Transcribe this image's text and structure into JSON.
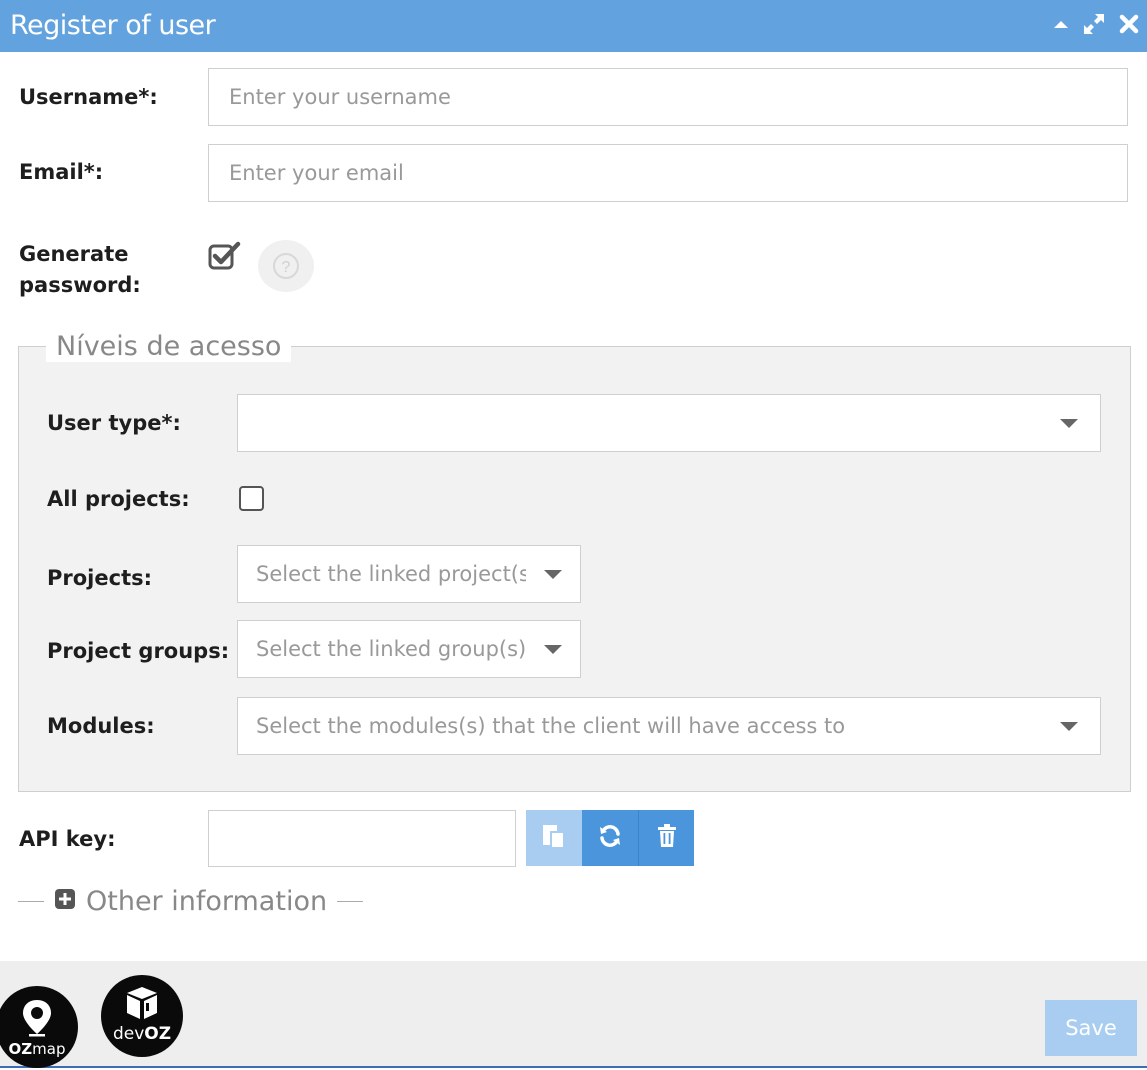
{
  "window": {
    "title": "Register of user"
  },
  "form": {
    "username": {
      "label": "Username*:",
      "placeholder": "Enter your username"
    },
    "email": {
      "label": "Email*:",
      "placeholder": "Enter your email"
    },
    "generate_password": {
      "label_line1": "Generate",
      "label_line2": "password:",
      "checked": true
    }
  },
  "access": {
    "legend": "Níveis de acesso",
    "user_type": {
      "label": "User type*:",
      "value": ""
    },
    "all_projects": {
      "label": "All projects:",
      "checked": false
    },
    "projects": {
      "label": "Projects:",
      "placeholder": "Select the linked project(s"
    },
    "project_groups": {
      "label": "Project groups:",
      "placeholder": "Select the linked group(s)"
    },
    "modules": {
      "label": "Modules:",
      "placeholder": "Select the modules(s) that the client will have access to"
    }
  },
  "api_key": {
    "label": "API key:",
    "value": ""
  },
  "other_information": {
    "label": "Other information"
  },
  "footer": {
    "save_label": "Save",
    "logo1": {
      "prefix": "OZ",
      "suffix": "map"
    },
    "logo2": {
      "prefix": "dev",
      "suffix": "OZ"
    }
  },
  "colors": {
    "header": "#62a2df",
    "button": "#4b95dc",
    "button_disabled": "#a8cdf0"
  },
  "icons": [
    "collapse-icon",
    "expand-icon",
    "close-icon",
    "checkbox-checked-icon",
    "help-icon",
    "copy-icon",
    "refresh-icon",
    "trash-icon",
    "plus-square-icon"
  ]
}
